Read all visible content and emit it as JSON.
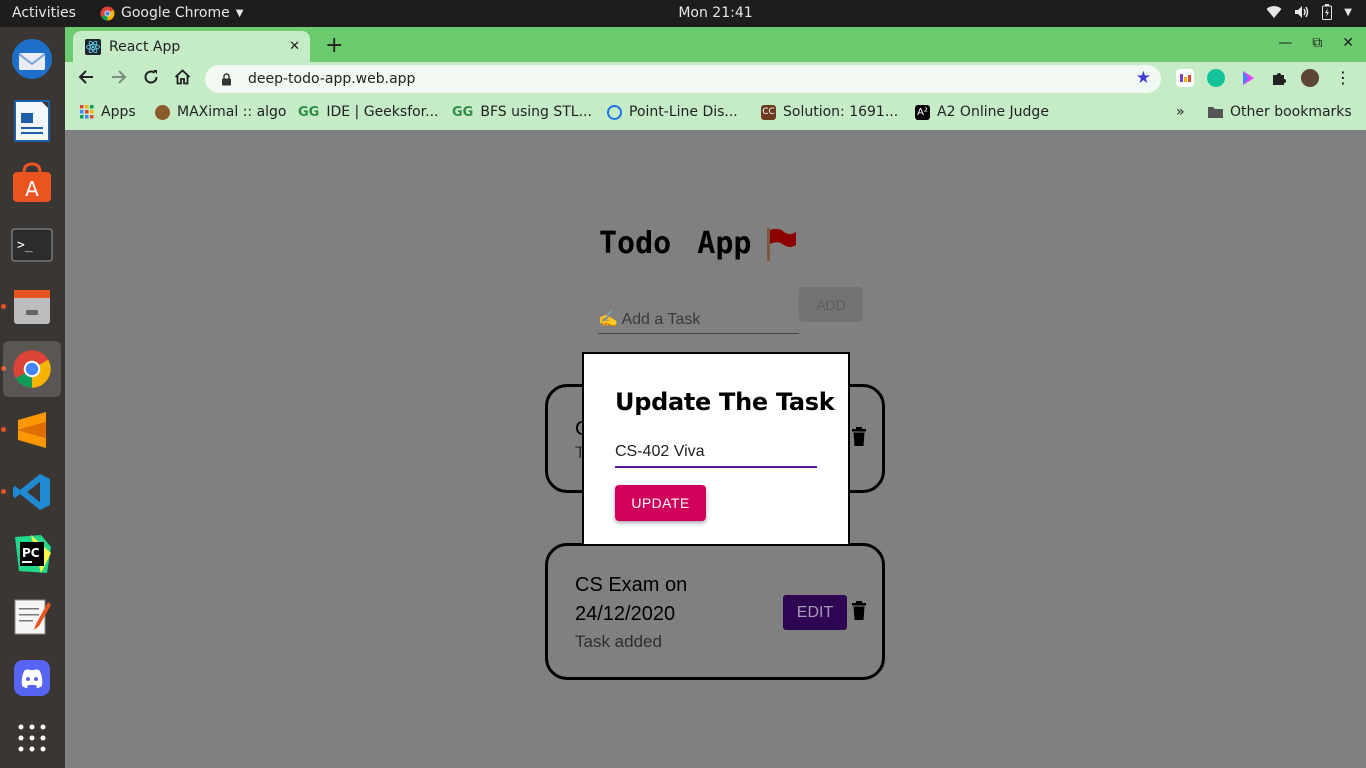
{
  "system": {
    "activities_label": "Activities",
    "app_name": "Google Chrome",
    "clock": "Mon 21:41"
  },
  "browser": {
    "tab_title": "React App",
    "url": "deep-todo-app.web.app",
    "bookmarks": [
      {
        "label": "Apps"
      },
      {
        "label": "MAXimal :: algo"
      },
      {
        "label": "IDE | Geeksfor..."
      },
      {
        "label": "BFS using STL..."
      },
      {
        "label": "Point-Line Dis..."
      },
      {
        "label": "Solution: 1691..."
      },
      {
        "label": "A2 Online Judge"
      }
    ],
    "more_bookmarks": "»",
    "other_bookmarks": "Other bookmarks"
  },
  "app": {
    "title": "Todo App",
    "input_placeholder": "✍ Add a Task",
    "add_label": "ADD",
    "tasks": [
      {
        "text": "C",
        "sub": "T"
      },
      {
        "text": "CS Exam on 24/12/2020",
        "sub": "Task added",
        "edit_label": "EDIT"
      }
    ]
  },
  "modal": {
    "title": "Update The Task",
    "input_value": "CS-402 Viva",
    "update_label": "UPDATE"
  },
  "colors": {
    "chrome_frame": "#6ccb6e",
    "toolbar": "#c6ecc7",
    "update_button": "#d1005a",
    "edit_button": "#2e0552",
    "input_underline": "#5b1791",
    "overlay": "#808080"
  }
}
